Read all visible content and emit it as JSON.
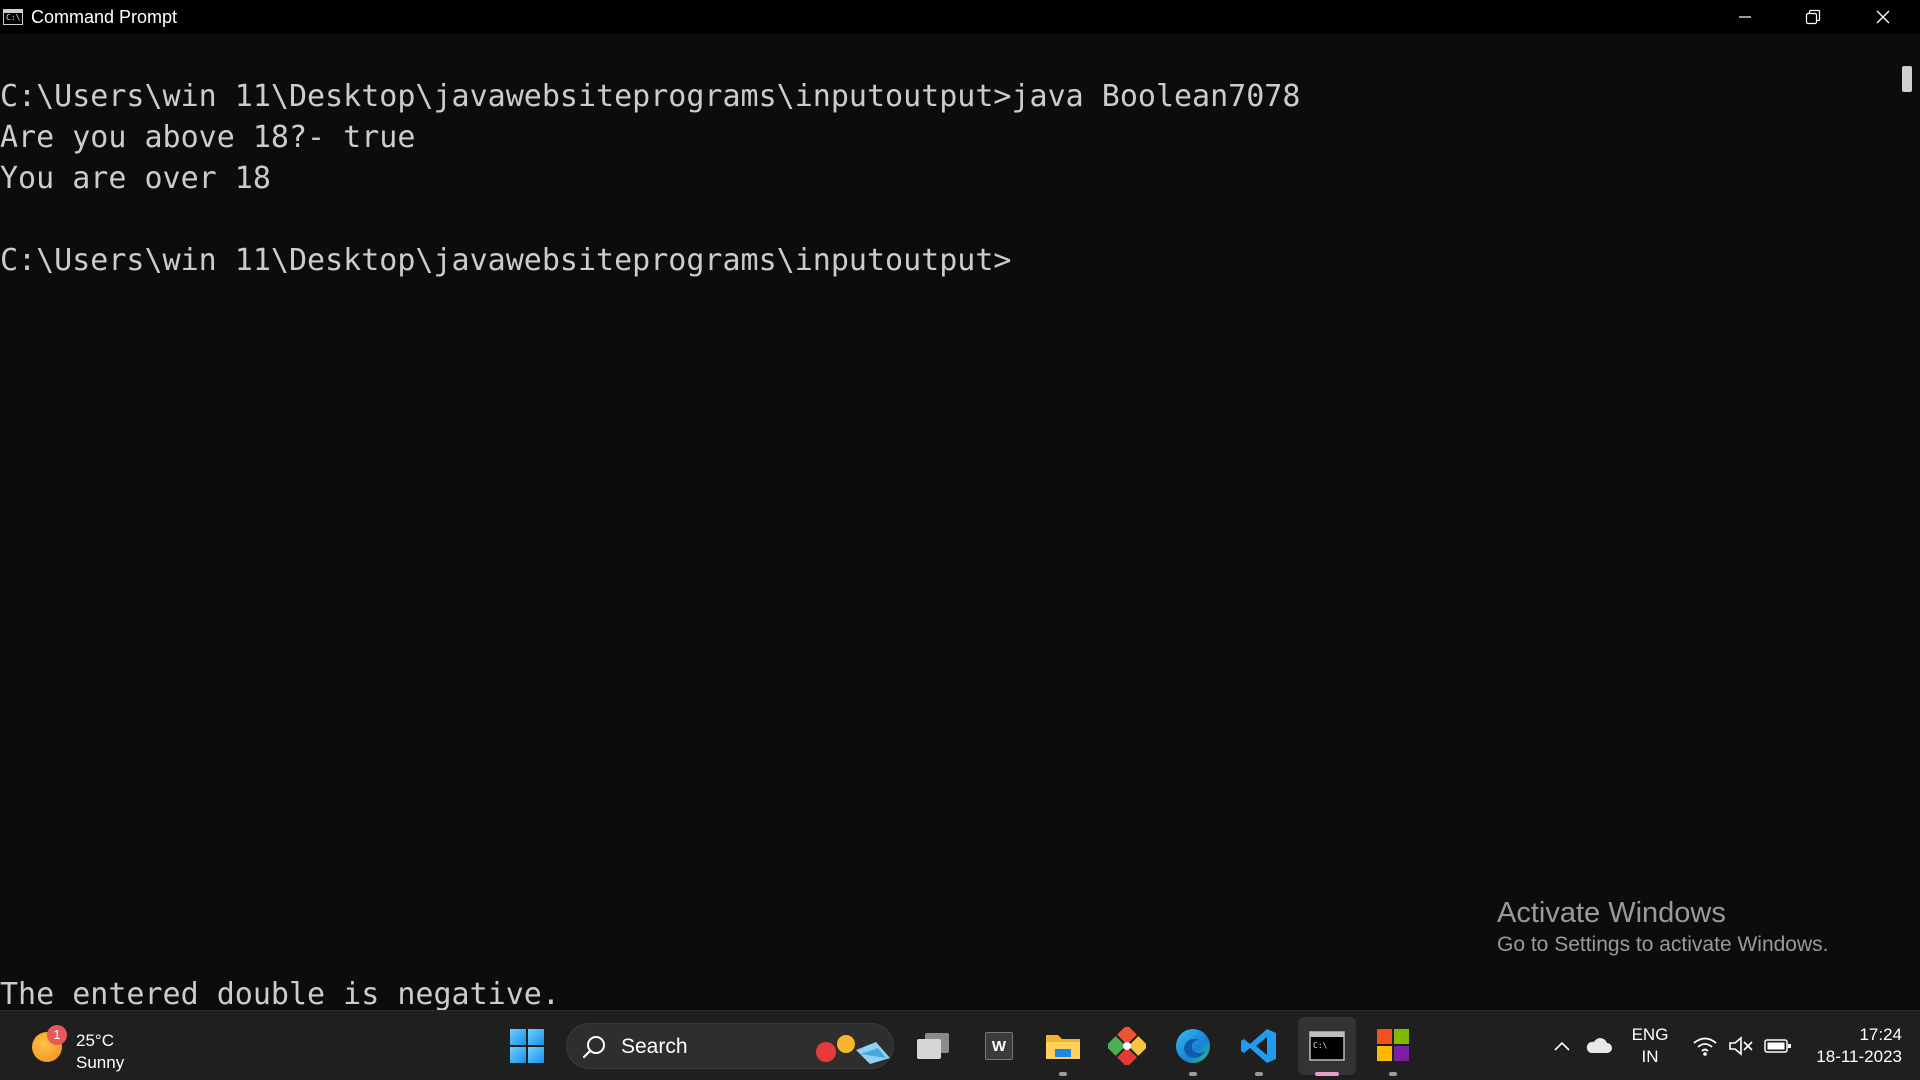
{
  "window": {
    "title": "Command Prompt",
    "icon_label": "C:\\"
  },
  "console": {
    "lines": [
      "C:\\Users\\win 11\\Desktop\\javawebsiteprograms\\inputoutput>java Boolean7078",
      "Are you above 18?- true",
      "You are over 18",
      "",
      "C:\\Users\\win 11\\Desktop\\javawebsiteprograms\\inputoutput>"
    ],
    "bottom_line": "The entered double is negative."
  },
  "watermark": {
    "title": "Activate Windows",
    "subtitle": "Go to Settings to activate Windows."
  },
  "taskbar": {
    "weather": {
      "temperature": "25°C",
      "condition": "Sunny",
      "badge": "1"
    },
    "search": {
      "label": "Search"
    },
    "word_label": "W",
    "tray": {
      "lang_line1": "ENG",
      "lang_line2": "IN",
      "time": "17:24",
      "date": "18-11-2023"
    }
  },
  "colors": {
    "console_background": "#0c0c0c",
    "console_text": "#cccccc",
    "taskbar_background": "#1f1f1f",
    "active_indicator": "#e79ccf"
  },
  "icons": [
    "start-icon",
    "search-icon",
    "task-view-icon",
    "word-icon",
    "file-explorer-icon",
    "git-icon",
    "edge-icon",
    "vscode-icon",
    "command-prompt-icon",
    "store-icon",
    "chevron-up-icon",
    "cloud-icon",
    "wifi-icon",
    "volume-muted-icon",
    "battery-icon"
  ]
}
